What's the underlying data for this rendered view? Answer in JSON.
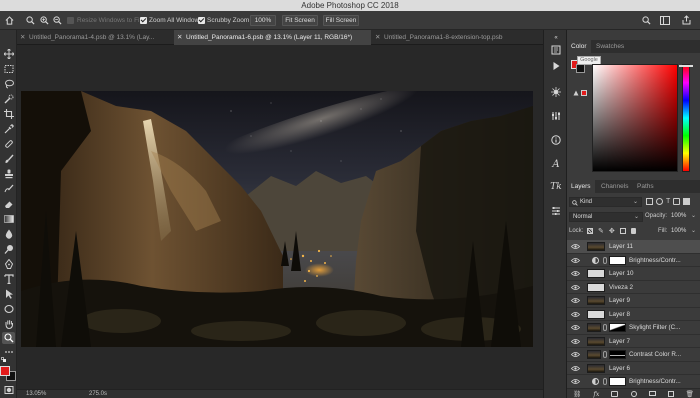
{
  "window": {
    "title": "Adobe Photoshop CC 2018"
  },
  "options_bar": {
    "resize_windows": "Resize Windows to Fit",
    "zoom_all": "Zoom All Windows",
    "scrubby_zoom": "Scrubby Zoom",
    "zoom_level": "100%",
    "fit_screen": "Fit Screen",
    "fill_screen": "Fill Screen"
  },
  "tabs": [
    {
      "label": "Untitled_Panorama1-4.psb @ 13.1% (Lay...",
      "active": false
    },
    {
      "label": "Untitled_Panorama1-6.psb @ 13.1% (Layer 11, RGB/16*)",
      "active": true
    },
    {
      "label": "Untitled_Panorama1-8-extension-top.psb",
      "active": false
    }
  ],
  "status_bar": {
    "zoom": "13.05%",
    "size": "275.0s"
  },
  "color_panel": {
    "tabs": [
      "Color",
      "Swatches"
    ],
    "tooltip": "Google",
    "foreground": "#e21b1b",
    "background": "#111111"
  },
  "layers_panel": {
    "tabs": [
      "Layers",
      "Channels",
      "Paths"
    ],
    "filter": "Kind",
    "blend_mode": "Normal",
    "opacity_label": "Opacity:",
    "opacity_value": "100%",
    "lock_label": "Lock:",
    "fill_label": "Fill:",
    "fill_value": "100%",
    "layers": [
      {
        "name": "Layer 11",
        "type": "image",
        "selected": true
      },
      {
        "name": "Brightness/Contr...",
        "type": "adjustment",
        "selected": false
      },
      {
        "name": "Layer 10",
        "type": "blank",
        "selected": false
      },
      {
        "name": "Viveza 2",
        "type": "blank",
        "selected": false
      },
      {
        "name": "Layer 9",
        "type": "image",
        "selected": false
      },
      {
        "name": "Layer 8",
        "type": "blank",
        "selected": false
      },
      {
        "name": "Skylight Filter (C...",
        "type": "masked",
        "selected": false
      },
      {
        "name": "Layer 7",
        "type": "image",
        "selected": false
      },
      {
        "name": "Contrast Color R...",
        "type": "masked",
        "selected": false
      },
      {
        "name": "Layer 6",
        "type": "image",
        "selected": false
      },
      {
        "name": "Brightness/Contr...",
        "type": "adjustment",
        "selected": false
      }
    ]
  },
  "colors": {
    "accent_fg": "#e21b1b",
    "panel_bg": "#3b3b3b",
    "selected_row": "#4e4e4e"
  }
}
